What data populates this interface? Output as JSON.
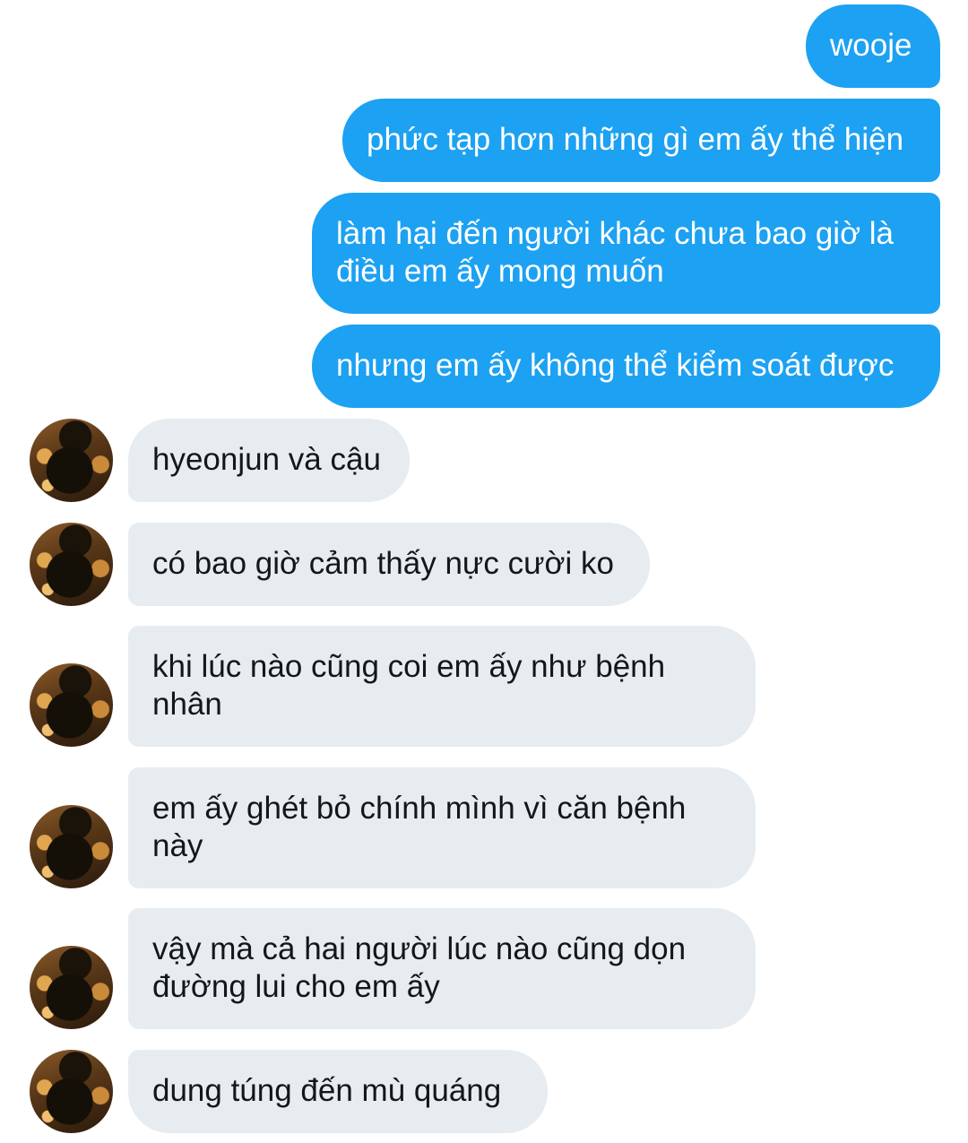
{
  "conversation": {
    "sent": [
      "wooje",
      "phức tạp hơn những gì em ấy thể hiện",
      "làm hại đến người khác chưa bao giờ là",
      "điều em ấy mong muốn",
      "nhưng em ấy không thể kiểm soát được"
    ],
    "received": [
      "hyeonjun và cậu",
      "có bao giờ cảm thấy nực cười ko",
      "khi lúc nào cũng coi em ấy như bệnh",
      "nhân",
      "em ấy ghét bỏ chính mình vì căn bệnh",
      "này",
      "vậy mà cả hai người lúc nào cũng dọn",
      "đường lui cho em ấy",
      "dung túng đến mù quáng"
    ]
  },
  "colors": {
    "sent_bubble": "#1da1f2",
    "received_bubble": "#e6ecf0",
    "sent_text": "#ffffff",
    "received_text": "#14171a"
  },
  "icons": {
    "avatar": "contact-avatar"
  }
}
